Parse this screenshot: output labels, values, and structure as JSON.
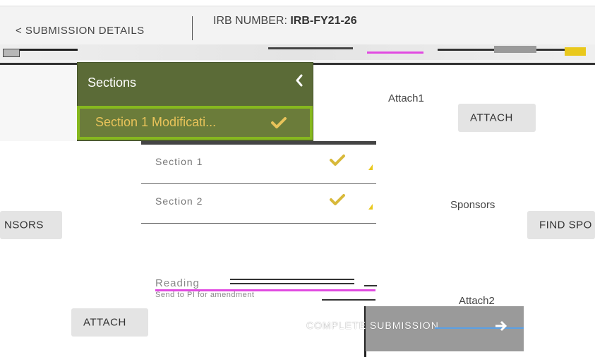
{
  "header": {
    "back_link": "< SUBMISSION DETAILS",
    "irb_label": "IRB NUMBER: ",
    "irb_value": "IRB-FY21-26"
  },
  "sections_panel": {
    "title": "Sections",
    "active_section": "Section 1 Modificati...",
    "items": [
      {
        "label": "Section 1"
      },
      {
        "label": "Section 2"
      }
    ]
  },
  "fields": {
    "attach1_label": "Attach1",
    "attach1_button": "ATTACH",
    "sponsors_label": "Sponsors",
    "find_sponsor_button": "FIND SPO",
    "sponsors_left_button": "NSORS",
    "attach2_label": "Attach2",
    "attach2_button": "ATTACH"
  },
  "reading": {
    "label": "Reading",
    "sub": "Send to PI for amendment"
  },
  "footer": {
    "complete_button": "COMPLETE SUBMISSION"
  },
  "colors": {
    "panel_green": "#5b6b37",
    "active_border": "#86b81e",
    "active_text": "#e9c35a",
    "check_gold": "#d8b93a"
  }
}
